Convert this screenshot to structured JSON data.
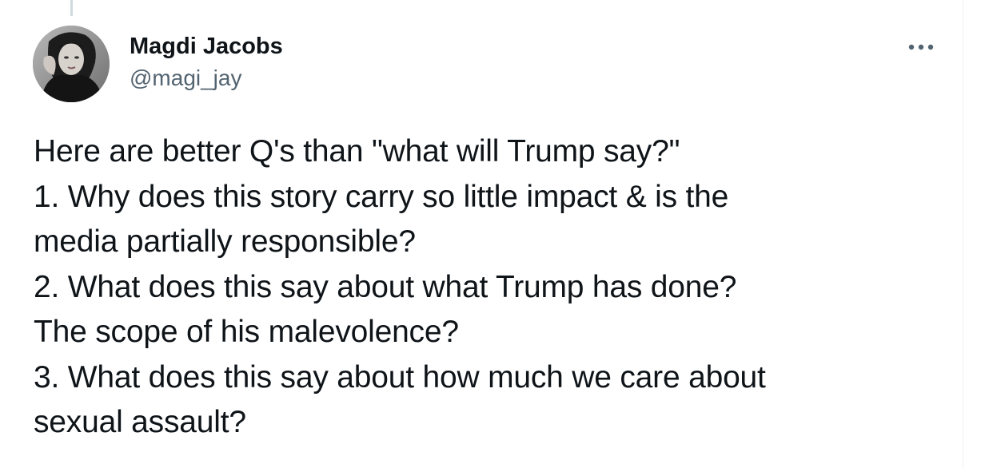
{
  "tweet": {
    "author": {
      "name": "Magdi Jacobs",
      "handle": "@magi_jay",
      "avatar_icon": "profile-photo-avatar"
    },
    "more_icon": "more-horizontal-icon",
    "lines": [
      "Here are better Q's than \"what will Trump say?\"",
      "1. Why does this story carry so little impact & is the",
      "media partially responsible?",
      "2. What does this say about what Trump has done?",
      "The scope of his malevolence?",
      "3. What does this say about how much we care about",
      "sexual assault?"
    ]
  },
  "colors": {
    "text_primary": "#0f1419",
    "text_secondary": "#536471",
    "thread_line": "#cfd9de",
    "background": "#ffffff"
  }
}
